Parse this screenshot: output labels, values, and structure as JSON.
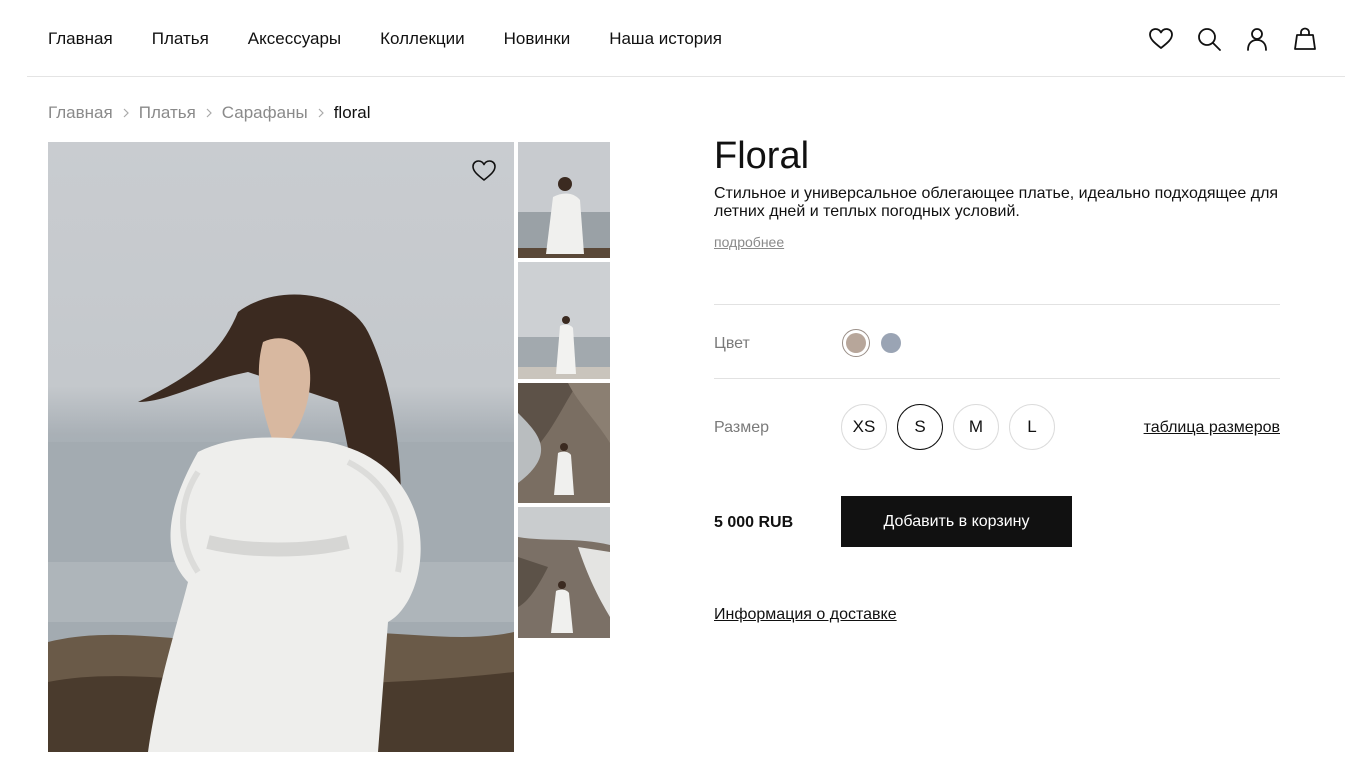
{
  "nav": {
    "items": [
      {
        "label": "Главная"
      },
      {
        "label": "Платья"
      },
      {
        "label": "Аксессуары"
      },
      {
        "label": "Коллекции"
      },
      {
        "label": "Новинки"
      },
      {
        "label": "Наша история"
      }
    ]
  },
  "header_icons": [
    "heart-icon",
    "search-icon",
    "user-icon",
    "bag-icon"
  ],
  "breadcrumb": {
    "items": [
      {
        "label": "Главная"
      },
      {
        "label": "Платья"
      },
      {
        "label": "Сарафаны"
      },
      {
        "label": "floral"
      }
    ]
  },
  "product": {
    "title": "Floral",
    "description": "Стильное и универсальное облегающее платье, идеально подходящее для летних дней и теплых погодных условий.",
    "more_link": "подробнее",
    "color_label": "Цвет",
    "colors": [
      {
        "hex": "#b7a69a",
        "selected": true
      },
      {
        "hex": "#9aa4b4",
        "selected": false
      }
    ],
    "size_label": "Размер",
    "sizes": [
      {
        "label": "XS",
        "selected": false
      },
      {
        "label": "S",
        "selected": true
      },
      {
        "label": "M",
        "selected": false
      },
      {
        "label": "L",
        "selected": false
      }
    ],
    "size_table_link": "таблица размеров",
    "price": "5 000 RUB",
    "add_to_cart": "Добавить в корзину",
    "delivery_link": "Информация о доставке"
  }
}
